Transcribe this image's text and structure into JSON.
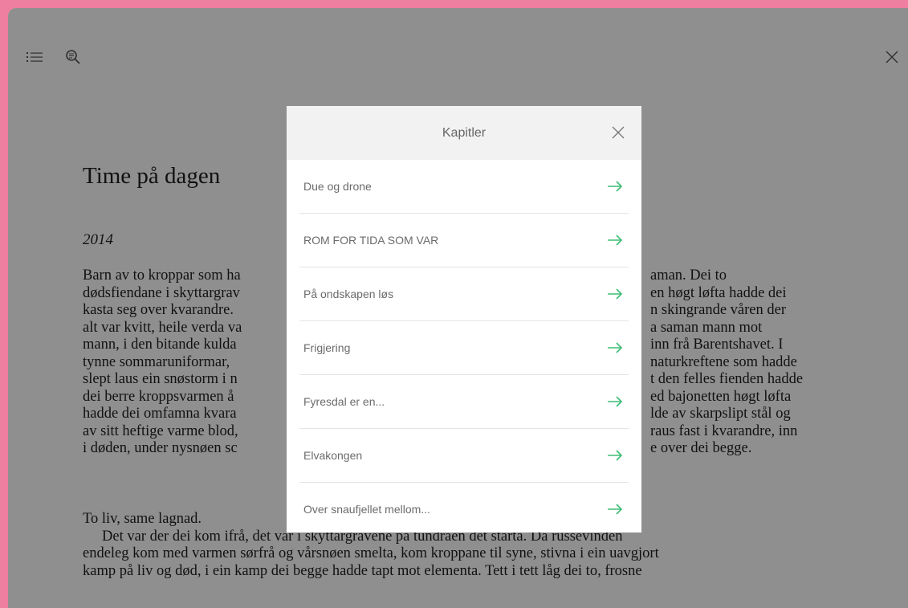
{
  "toolbar": {
    "toc_icon": "list-icon",
    "search_icon": "search-icon",
    "close_icon": "close-icon"
  },
  "book": {
    "title": "Time på dagen",
    "chapter_year": "2014",
    "paragraph1_lines": [
      "Barn av to kroppar som ha",
      "dødsfiendane i skyttargrav",
      "kasta seg over kvarandre.",
      "alt var kvitt, heile verda va",
      "mann, i den bitande kulda",
      "tynne sommaruniformar,",
      "slept laus ein snøstorm i n",
      "dei berre kroppsvarmen å",
      "hadde dei omfamna kvara",
      "av sitt heftige varme blod,",
      "i døden, under nysnøen sc"
    ],
    "paragraph1_right": [
      "aman. Dei to",
      "en høgt løfta hadde dei",
      "n skingrande våren der",
      "a saman mann mot",
      "inn frå Barentshavet. I",
      "naturkreftene som hadde",
      "t den felles fienden hadde",
      "ed bajonetten høgt løfta",
      "lde av skarpslipt stål og",
      "raus fast i kvarandre, inn",
      "e over dei begge."
    ],
    "paragraph2_lines": [
      "To liv, same lagnad.",
      "Det var der dei kom ifrå, det var i skyttargravene på tundraen det starta. Då russevinden",
      "endeleg kom med varmen sørfrå og vårsnøen smelta, kom kroppane til syne, stivna i ein uavgjort",
      "kamp på liv og død, i ein kamp dei begge hadde tapt mot elementa. Tett i tett låg dei to, frosne"
    ]
  },
  "modal": {
    "title": "Kapitler",
    "close_icon": "close-icon",
    "chapters": [
      "Due og drone",
      "ROM FOR TIDA SOM VAR",
      "På ondskapen løs",
      "Frigjering",
      "Fyresdal er en...",
      "Elvakongen",
      "Over snaufjellet mellom..."
    ],
    "arrow_icon": "arrow-right-icon",
    "arrow_color": "#3dbd75"
  },
  "colors": {
    "frame": "#ef7fa0",
    "overlay": "rgba(0,0,0,0.44)",
    "accent": "#3dbd75"
  }
}
